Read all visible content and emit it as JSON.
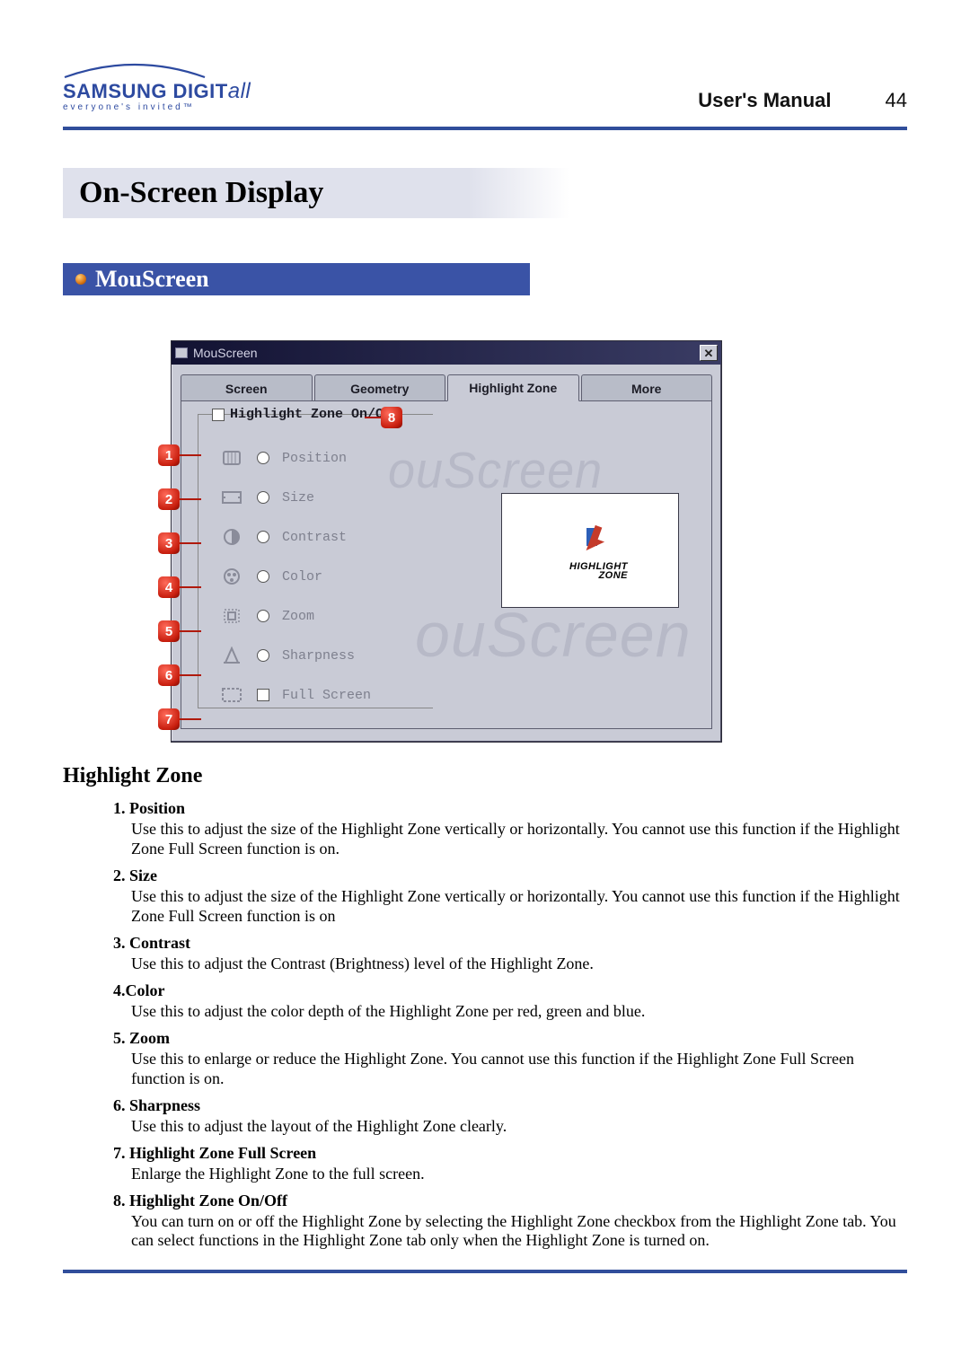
{
  "header": {
    "logo_main_1": "SAMSUNG DIGIT",
    "logo_main_2": "all",
    "logo_tagline": "everyone's invited™",
    "manual_label": "User's Manual",
    "page_number": "44"
  },
  "banners": {
    "page_title": "On-Screen Display",
    "section_title": "MouScreen"
  },
  "window": {
    "title": "MouScreen",
    "tabs": [
      "Screen",
      "Geometry",
      "Highlight Zone",
      "More"
    ],
    "active_tab_index": 2,
    "toggle_label": "Highlight Zone On/Off",
    "options": [
      {
        "id": 1,
        "label": "Position",
        "icon": "position-icon",
        "type": "radio"
      },
      {
        "id": 2,
        "label": "Size",
        "icon": "size-icon",
        "type": "radio"
      },
      {
        "id": 3,
        "label": "Contrast",
        "icon": "contrast-icon",
        "type": "radio"
      },
      {
        "id": 4,
        "label": "Color",
        "icon": "color-icon",
        "type": "radio"
      },
      {
        "id": 5,
        "label": "Zoom",
        "icon": "zoom-icon",
        "type": "radio"
      },
      {
        "id": 6,
        "label": "Sharpness",
        "icon": "sharpness-icon",
        "type": "radio"
      },
      {
        "id": 7,
        "label": "Full Screen",
        "icon": "fullscreen-icon",
        "type": "checkbox"
      }
    ],
    "preview_label_1": "HIGHLIGHT",
    "preview_label_2": "ZONE",
    "watermark": "ouScreen",
    "callout_toggle": 8
  },
  "description": {
    "heading": "Highlight Zone",
    "items": [
      {
        "num": "1.",
        "title": "Position",
        "body": "Use this to adjust the size of the Highlight Zone vertically or horizontally. You cannot use this function if the Highlight Zone Full Screen function is on."
      },
      {
        "num": "2.",
        "title": "Size",
        "body": "Use this to adjust the size of the Highlight Zone vertically or horizontally. You cannot use this function if the Highlight Zone Full Screen function is on"
      },
      {
        "num": "3.",
        "title": "Contrast",
        "body": "Use this to adjust the Contrast (Brightness) level of the Highlight Zone."
      },
      {
        "num": "4.",
        "title": "Color",
        "body": "Use this to adjust the color depth of the Highlight Zone per red, green and blue."
      },
      {
        "num": "5.",
        "title": "Zoom",
        "body": "Use this to enlarge or reduce the Highlight Zone. You cannot use this function if the Highlight Zone Full Screen function is on."
      },
      {
        "num": "6.",
        "title": "Sharpness",
        "body": "Use this to adjust the layout of the Highlight Zone clearly."
      },
      {
        "num": "7.",
        "title": "Highlight Zone Full Screen",
        "body": "Enlarge the Highlight Zone to the full screen."
      },
      {
        "num": "8.",
        "title": "Highlight Zone On/Off",
        "body": "You can turn on or off the Highlight Zone by selecting the Highlight Zone checkbox from the Highlight Zone tab. You can select functions in the Highlight Zone tab only when the Highlight Zone is turned on."
      }
    ]
  }
}
